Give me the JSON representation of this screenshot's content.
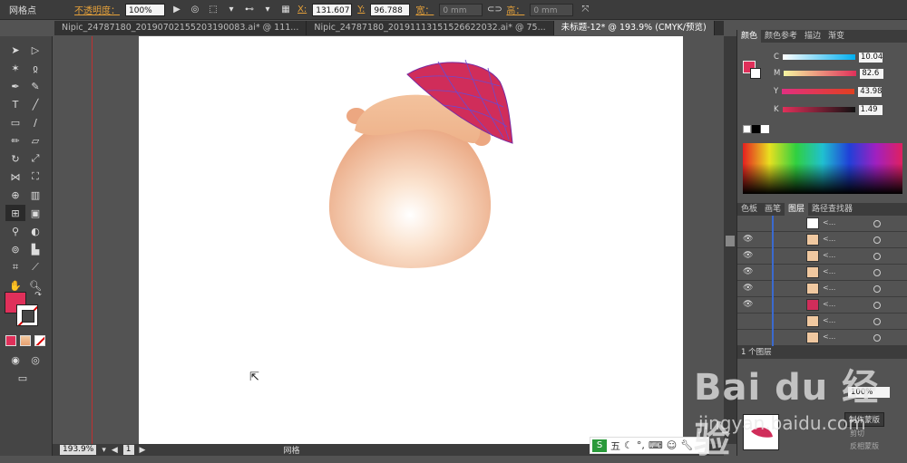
{
  "control_bar": {
    "mode_label": "网格点",
    "opacity_label": "不透明度：",
    "opacity_value": "100%",
    "x_label": "X:",
    "x_value": "131.607",
    "y_label": "Y:",
    "y_value": "96.788",
    "width_label": "宽：",
    "width_value": "0 mm",
    "height_label": "高：",
    "height_value": "0 mm"
  },
  "doc_tabs": [
    {
      "label": "Nipic_24787180_20190702155203190083.ai* @ 111..."
    },
    {
      "label": "Nipic_24787180_20191113151526622032.ai* @ 75..."
    },
    {
      "label": "未标题-12* @ 193.9% (CMYK/预览)"
    }
  ],
  "color_panel": {
    "tabs": [
      "颜色",
      "颜色参考",
      "描边",
      "渐变"
    ],
    "channels": [
      {
        "name": "C",
        "value": "10.04"
      },
      {
        "name": "M",
        "value": "82.6"
      },
      {
        "name": "Y",
        "value": "43.98"
      },
      {
        "name": "K",
        "value": "1.49"
      }
    ],
    "fill_color": "#e0305a"
  },
  "layers_panel": {
    "tabs": [
      "色板",
      "画笔",
      "图层",
      "路径查找器"
    ],
    "rows": [
      {
        "name": "<..."
      },
      {
        "name": "<..."
      },
      {
        "name": "<..."
      },
      {
        "name": "<..."
      },
      {
        "name": "<..."
      },
      {
        "name": "<..."
      },
      {
        "name": "<..."
      },
      {
        "name": "<..."
      }
    ],
    "footer": "1 个图层"
  },
  "transparency_panel": {
    "opacity": "100%",
    "make_mask": "制作蒙版",
    "clip": "剪切",
    "invert": "反相蒙版"
  },
  "status_bar": {
    "zoom": "193.9%",
    "page": "1",
    "tool": "网格"
  },
  "ime": {
    "label": "五"
  },
  "watermark": {
    "line1": "Bai du 经验",
    "line2": "jingyan.baidu.com"
  }
}
